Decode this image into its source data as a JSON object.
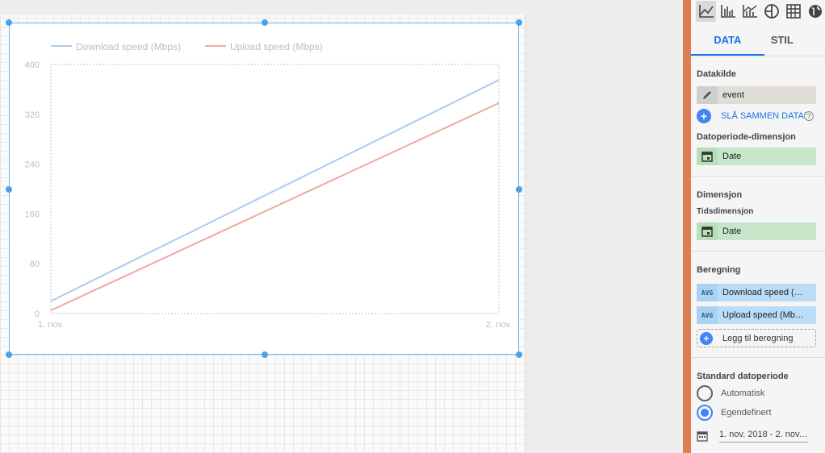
{
  "chart_type_icons": [
    "line-chart-icon",
    "bar-chart-icon",
    "combo-chart-icon",
    "pie-chart-icon",
    "table-icon",
    "geo-chart-icon"
  ],
  "tabs": {
    "data": "DATA",
    "style": "STIL"
  },
  "data_source": {
    "label": "Datakilde",
    "value": "event",
    "blend_label": "SLÅ SAMMEN DATAE"
  },
  "date_range_dimension": {
    "label": "Datoperiode-dimensjon",
    "value": "Date"
  },
  "dimension": {
    "label": "Dimensjon",
    "sublabel": "Tidsdimensjon",
    "value": "Date"
  },
  "metrics": {
    "label": "Beregning",
    "items": [
      {
        "agg": "AVG",
        "name": "Download speed (…"
      },
      {
        "agg": "AVG",
        "name": "Upload speed (Mb…"
      }
    ],
    "add_label": "Legg til beregning"
  },
  "default_date_range": {
    "label": "Standard datoperiode",
    "options": [
      {
        "label": "Automatisk",
        "selected": false
      },
      {
        "label": "Egendefinert",
        "selected": true
      }
    ],
    "range": "1. nov. 2018 - 2. nov. …"
  },
  "colors": {
    "accent": "#1a73e8",
    "download": "#aecbeb",
    "upload": "#eeaaa2",
    "selection": "#4fa1e4",
    "orange_strip": "#dd7d52"
  },
  "chart_data": {
    "type": "line",
    "x": [
      "1. nov.",
      "2. nov."
    ],
    "ylim": [
      0,
      400
    ],
    "yticks": [
      0,
      80,
      160,
      240,
      320,
      400
    ],
    "legend_position": "top-left",
    "series": [
      {
        "name": "Download speed (Mbps)",
        "values": [
          20,
          375
        ],
        "color": "#aecbeb"
      },
      {
        "name": "Upload speed (Mbps)",
        "values": [
          5,
          338
        ],
        "color": "#eeaaa2"
      }
    ]
  }
}
